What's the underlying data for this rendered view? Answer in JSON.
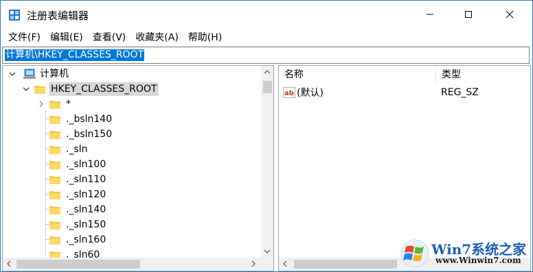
{
  "window": {
    "title": "注册表编辑器",
    "app_icon": "registry-editor-icon",
    "controls": {
      "minimize": "minimize-icon",
      "maximize": "maximize-icon",
      "close": "close-icon"
    }
  },
  "menubar": {
    "items": [
      {
        "label": "文件(F)"
      },
      {
        "label": "编辑(E)"
      },
      {
        "label": "查看(V)"
      },
      {
        "label": "收藏夹(A)"
      },
      {
        "label": "帮助(H)"
      }
    ]
  },
  "address": {
    "value": "计算机\\HKEY_CLASSES_ROOT"
  },
  "tree": {
    "root": {
      "label": "计算机",
      "icon": "computer-icon"
    },
    "hive": {
      "label": "HKEY_CLASSES_ROOT",
      "icon": "folder-icon",
      "selected": true
    },
    "keys": [
      {
        "label": "*"
      },
      {
        "label": "._bsln140"
      },
      {
        "label": "._bsln150"
      },
      {
        "label": "._sln"
      },
      {
        "label": "._sln100"
      },
      {
        "label": "._sln110"
      },
      {
        "label": "._sln120"
      },
      {
        "label": "._sln140"
      },
      {
        "label": "._sln150"
      },
      {
        "label": "._sln160"
      },
      {
        "label": "._sln60"
      }
    ]
  },
  "values": {
    "columns": {
      "name": "名称",
      "type": "类型"
    },
    "rows": [
      {
        "name": "(默认)",
        "type": "REG_SZ",
        "icon": "string-value-icon"
      }
    ]
  },
  "watermark": {
    "title": "Win7系统之家",
    "url": "www.Winwin7.com"
  },
  "colors": {
    "selection": "#0078d7",
    "tree_selection": "#d9d9d9",
    "folder": "#f5c84c",
    "brand": "#1d5fb5"
  }
}
